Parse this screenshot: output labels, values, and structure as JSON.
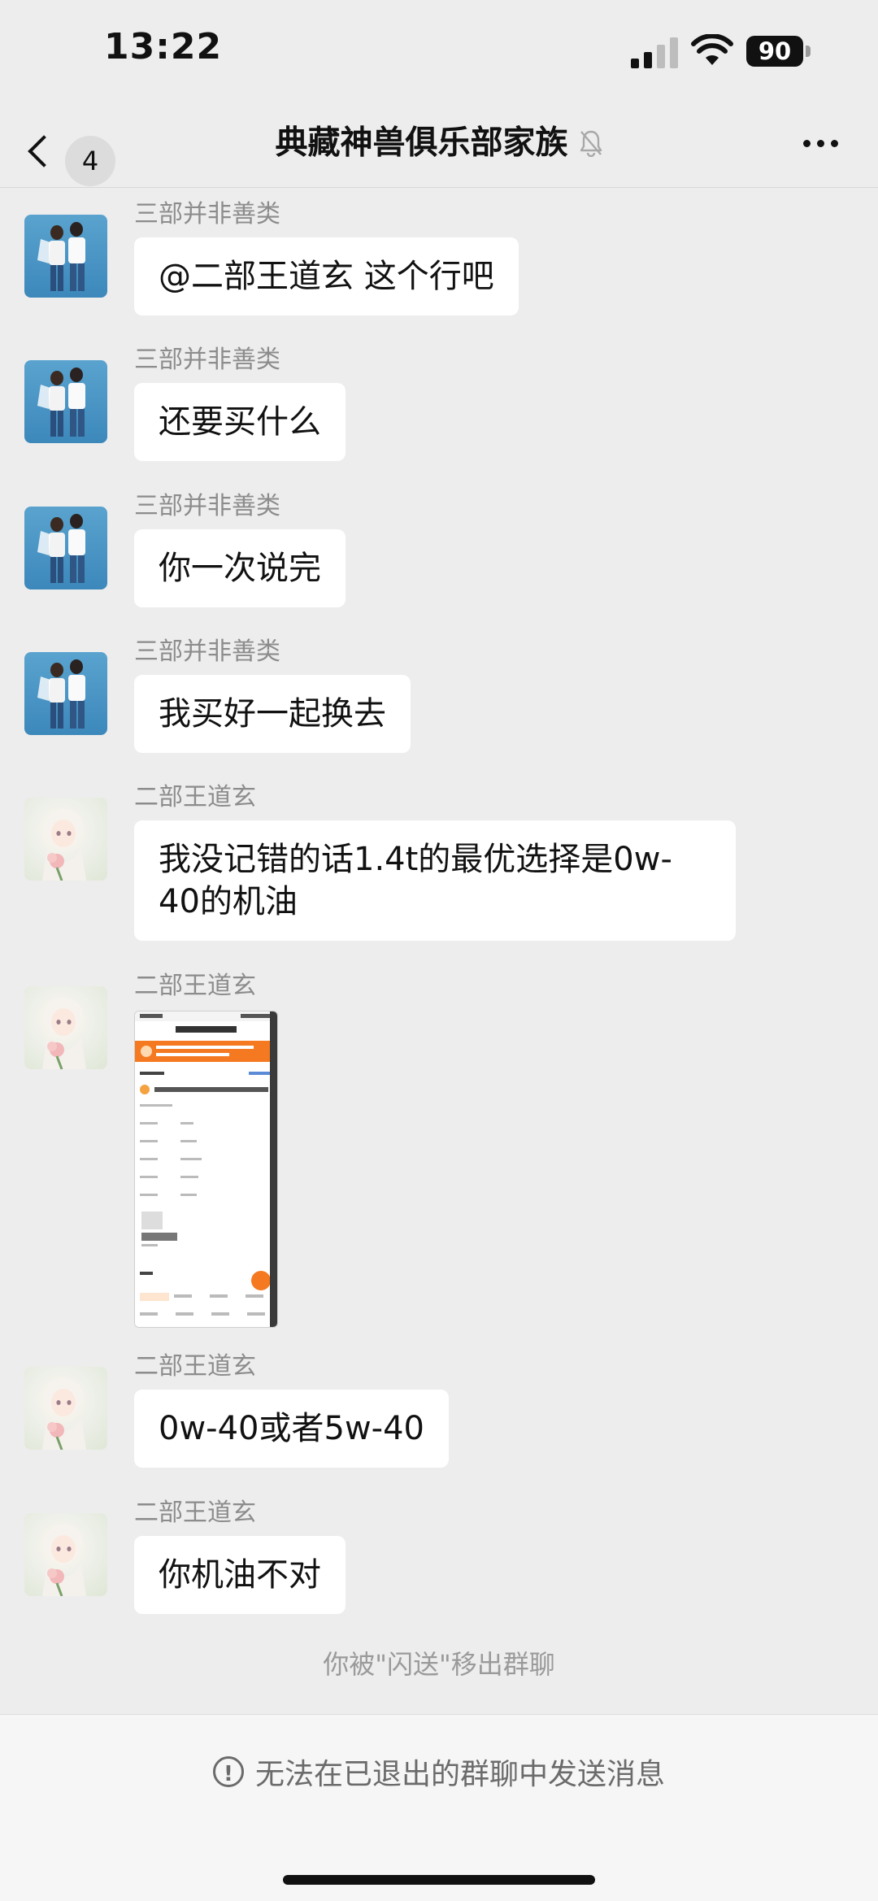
{
  "status_bar": {
    "time": "13:22",
    "battery": "90"
  },
  "nav": {
    "back_badge": "4",
    "title": "典藏神兽俱乐部家族"
  },
  "messages": [
    {
      "sender": "三部并非善类",
      "text": "@二部王道玄 这个行吧"
    },
    {
      "sender": "三部并非善类",
      "text": "还要买什么"
    },
    {
      "sender": "三部并非善类",
      "text": "你一次说完"
    },
    {
      "sender": "三部并非善类",
      "text": "我买好一起换去"
    },
    {
      "sender": "二部王道玄",
      "text": "我没记错的话1.4t的最优选择是0w-40的机油"
    },
    {
      "sender": "二部王道玄",
      "text": ""
    },
    {
      "sender": "二部王道玄",
      "text": "0w-40或者5w-40"
    },
    {
      "sender": "二部王道玄",
      "text": "你机油不对"
    }
  ],
  "system_notice": "你被\"闪送\"移出群聊",
  "bottom_notice": "无法在已退出的群聊中发送消息",
  "colors": {
    "background": "#ededed",
    "bubble": "#ffffff",
    "accent_orange": "#f47920"
  }
}
